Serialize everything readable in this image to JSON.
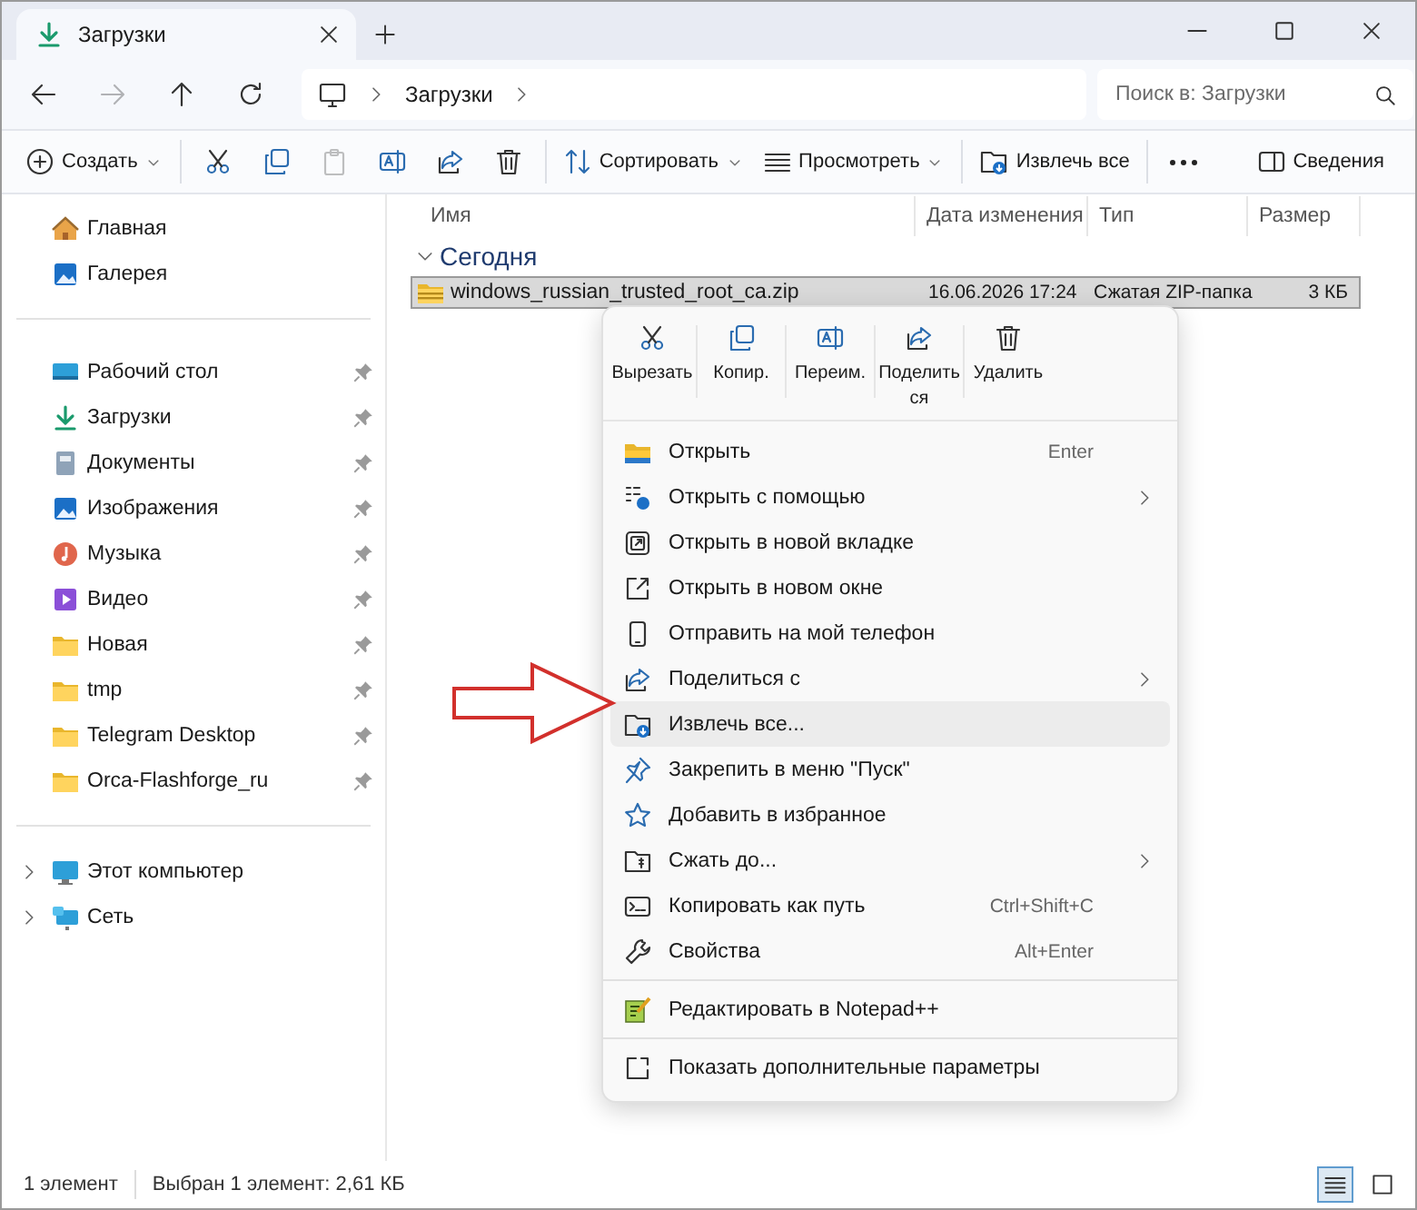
{
  "window": {
    "tab_title": "Загрузки"
  },
  "nav": {
    "buttons": [
      {
        "kind": "back",
        "disabled": false
      },
      {
        "kind": "forward",
        "disabled": true
      },
      {
        "kind": "up",
        "disabled": false
      },
      {
        "kind": "refresh",
        "disabled": false
      }
    ],
    "breadcrumb": [
      "Загрузки"
    ],
    "search_placeholder": "Поиск в: Загрузки"
  },
  "toolbar": {
    "left": [
      {
        "kind": "create",
        "label": "Создать",
        "dropdown": true,
        "disabled": false
      },
      {
        "kind": "separator"
      },
      {
        "kind": "cut",
        "disabled": false
      },
      {
        "kind": "copy",
        "disabled": false
      },
      {
        "kind": "paste",
        "disabled": true
      },
      {
        "kind": "rename",
        "disabled": false
      },
      {
        "kind": "share",
        "disabled": false
      },
      {
        "kind": "delete",
        "disabled": false
      },
      {
        "kind": "separator"
      },
      {
        "kind": "sort",
        "label": "Сортировать",
        "dropdown": true,
        "disabled": false
      },
      {
        "kind": "view",
        "label": "Просмотреть",
        "dropdown": true,
        "disabled": false
      },
      {
        "kind": "separator"
      },
      {
        "kind": "extract",
        "label": "Извлечь все",
        "dropdown": false,
        "disabled": false
      },
      {
        "kind": "separator"
      },
      {
        "kind": "more",
        "disabled": false
      }
    ],
    "right": [
      {
        "kind": "details",
        "label": "Сведения",
        "dropdown": false,
        "disabled": false
      }
    ]
  },
  "sidebar": {
    "groups": [
      [
        {
          "kind": "home",
          "label": "Главная",
          "pinned": false
        },
        {
          "kind": "gallery",
          "label": "Галерея",
          "pinned": false
        }
      ],
      [
        {
          "kind": "desktop",
          "label": "Рабочий стол",
          "pinned": true
        },
        {
          "kind": "downloads",
          "label": "Загрузки",
          "pinned": true
        },
        {
          "kind": "documents",
          "label": "Документы",
          "pinned": true
        },
        {
          "kind": "pictures",
          "label": "Изображения",
          "pinned": true
        },
        {
          "kind": "music",
          "label": "Музыка",
          "pinned": true
        },
        {
          "kind": "video",
          "label": "Видео",
          "pinned": true
        },
        {
          "kind": "folder",
          "label": "Новая",
          "pinned": true
        },
        {
          "kind": "folder",
          "label": "tmp",
          "pinned": true
        },
        {
          "kind": "folder",
          "label": "Telegram Desktop",
          "pinned": true
        },
        {
          "kind": "folder",
          "label": "Orca-Flashforge_ru",
          "pinned": true
        }
      ],
      [
        {
          "kind": "computer",
          "label": "Этот компьютер",
          "expanded": false
        },
        {
          "kind": "network",
          "label": "Сеть",
          "expanded": false
        }
      ]
    ]
  },
  "files": {
    "columns": [
      "Имя",
      "Дата изменения",
      "Тип",
      "Размер"
    ],
    "groups": [
      {
        "title": "Сегодня",
        "expanded": true,
        "rows": [
          {
            "kind": "zip",
            "name": "windows_russian_trusted_root_ca.zip",
            "date": "16.06.2026 17:24",
            "type": "Сжатая ZIP-папка",
            "size": "3 КБ",
            "selected": true
          }
        ]
      }
    ]
  },
  "context_menu": {
    "actions": [
      {
        "kind": "cut",
        "label": "Вырезать"
      },
      {
        "kind": "copy",
        "label": "Копир."
      },
      {
        "kind": "rename",
        "label": "Переим."
      },
      {
        "kind": "share",
        "label": "Поделиться"
      },
      {
        "kind": "delete",
        "label": "Удалить"
      }
    ],
    "items": [
      {
        "kind": "open",
        "label": "Открыть",
        "shortcut": "Enter",
        "submenu": false,
        "selected": false
      },
      {
        "kind": "openwith",
        "label": "Открыть с помощью",
        "submenu": true,
        "selected": false
      },
      {
        "kind": "newtab",
        "label": "Открыть в новой вкладке",
        "submenu": false,
        "selected": false
      },
      {
        "kind": "newwindow",
        "label": "Открыть в новом окне",
        "submenu": false,
        "selected": false
      },
      {
        "kind": "phone",
        "label": "Отправить на мой телефон",
        "submenu": false,
        "selected": false
      },
      {
        "kind": "share",
        "label": "Поделиться с",
        "submenu": true,
        "selected": false
      },
      {
        "kind": "extract",
        "label": "Извлечь все...",
        "submenu": false,
        "selected": true
      },
      {
        "kind": "pin",
        "label": "Закрепить в меню \"Пуск\"",
        "submenu": false,
        "selected": false
      },
      {
        "kind": "star",
        "label": "Добавить в избранное",
        "submenu": false,
        "selected": false
      },
      {
        "kind": "compress",
        "label": "Сжать до...",
        "submenu": true,
        "selected": false
      },
      {
        "kind": "copypath",
        "label": "Копировать как путь",
        "shortcut": "Ctrl+Shift+C",
        "submenu": false,
        "selected": false
      },
      {
        "kind": "properties",
        "label": "Свойства",
        "shortcut": "Alt+Enter",
        "submenu": false,
        "selected": false
      },
      {
        "kind": "separator"
      },
      {
        "kind": "notepad",
        "label": "Редактировать в Notepad++",
        "submenu": false,
        "selected": false
      },
      {
        "kind": "separator"
      },
      {
        "kind": "moreoptions",
        "label": "Показать дополнительные параметры",
        "submenu": false,
        "selected": false
      }
    ]
  },
  "status_bar": {
    "texts": [
      "1 элемент",
      "Выбран 1 элемент: 2,61 КБ"
    ],
    "views": [
      {
        "kind": "details",
        "selected": true
      },
      {
        "kind": "tiles",
        "selected": false
      }
    ]
  }
}
